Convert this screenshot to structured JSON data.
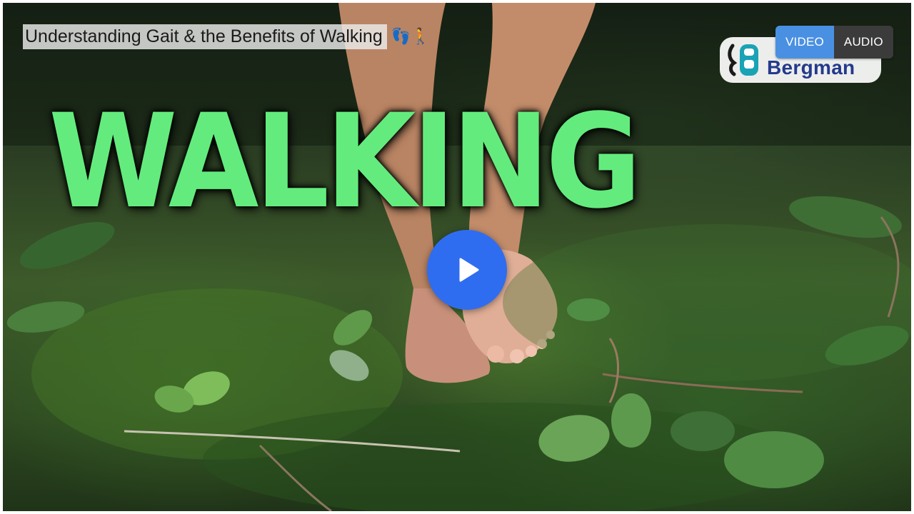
{
  "video": {
    "title": "Understanding Gait & the Benefits of Walking",
    "title_emoji": "👣🚶",
    "thumbnail_headline": "WALKING",
    "headline_color": "#63ec7d"
  },
  "media_toggle": {
    "options": [
      "VIDEO",
      "AUDIO"
    ],
    "selected": "VIDEO",
    "active_color": "#4a90e2",
    "inactive_color": "#3b3b3b"
  },
  "logo": {
    "text": "Bergman",
    "icon": "spine-logo-icon"
  },
  "controls": {
    "play_icon": "play-icon",
    "play_color": "#2f6df0"
  }
}
